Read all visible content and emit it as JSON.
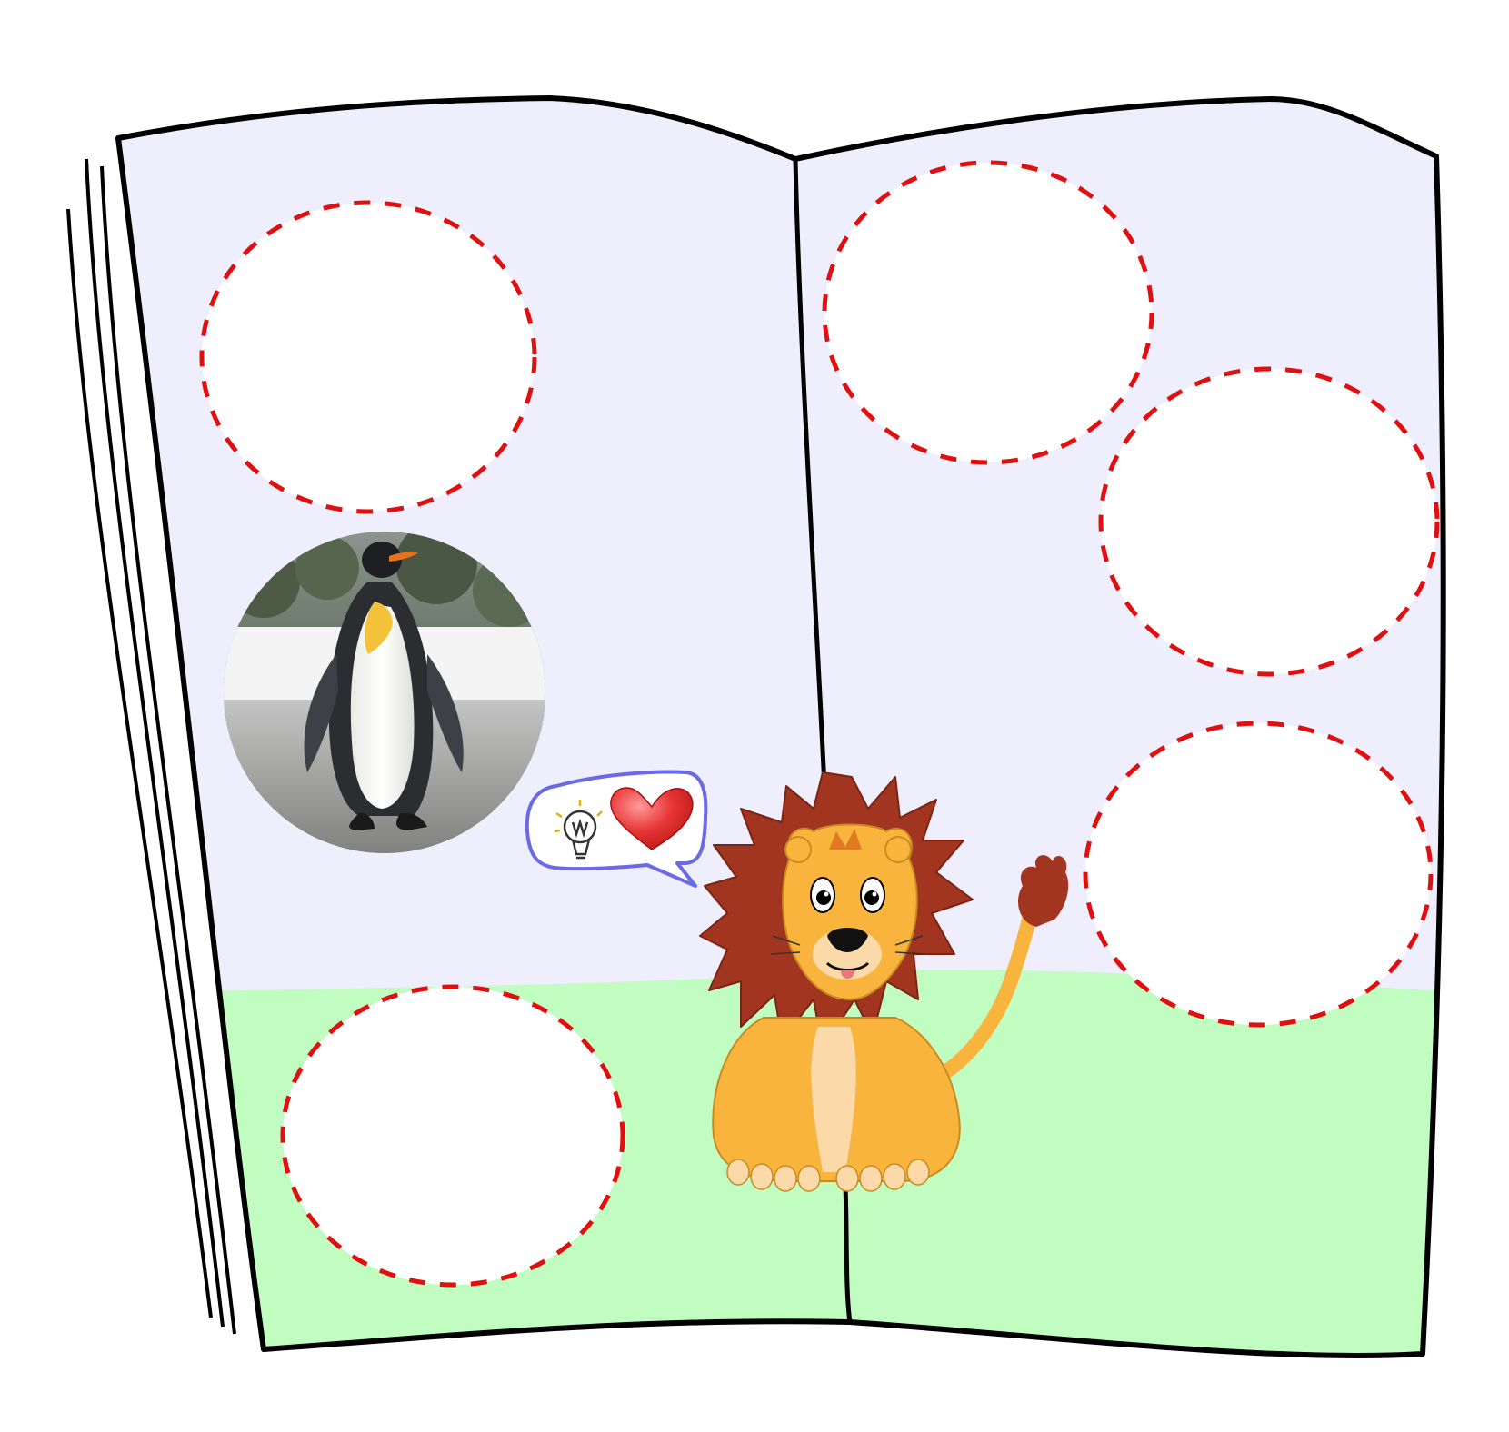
{
  "game": {
    "type": "drag-and-drop",
    "colors": {
      "page_top": "#efeefc",
      "grass": "#c1fcc1",
      "outline": "#000000",
      "slot_fill": "#ffffff",
      "slot_border": "#e01010",
      "bubble_border": "#6a6ae6",
      "heart": "#e83535",
      "lion_body": "#f8b43c",
      "lion_mane": "#a23520",
      "lion_chest": "#fbd9a8"
    },
    "book": {
      "icon": "open-book-icon",
      "left_page": {
        "empty_slots": [
          {
            "id": "slot-left-1",
            "icon": "empty-circle-slot",
            "filled": false
          },
          {
            "id": "slot-left-2",
            "icon": "empty-circle-slot",
            "filled": false
          }
        ],
        "placed_items": [
          {
            "id": "penguin-photo",
            "icon": "penguin-photo",
            "animal": "penguin",
            "filled": true
          }
        ]
      },
      "right_page": {
        "empty_slots": [
          {
            "id": "slot-right-1",
            "icon": "empty-circle-slot",
            "filled": false
          },
          {
            "id": "slot-right-2",
            "icon": "empty-circle-slot",
            "filled": false
          },
          {
            "id": "slot-right-3",
            "icon": "empty-circle-slot",
            "filled": false
          }
        ]
      }
    },
    "mascot": {
      "animal": "lion",
      "icon": "lion-mascot-icon",
      "speech_bubble": {
        "icons": [
          "lightbulb-icon",
          "heart-icon"
        ]
      }
    }
  }
}
